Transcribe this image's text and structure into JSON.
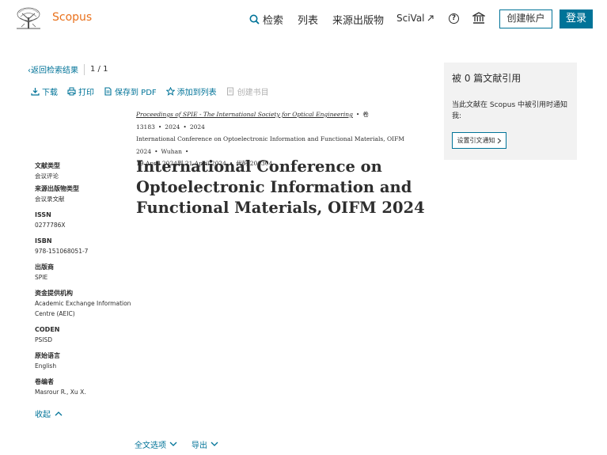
{
  "header": {
    "brand": "Scopus",
    "search_label": "检索",
    "lists_label": "列表",
    "sources_label": "来源出版物",
    "scival_label": "SciVal",
    "create_account_label": "创建帐户",
    "login_label": "登录"
  },
  "nav": {
    "back_label": "返回检索结果",
    "pager": "1 / 1"
  },
  "toolbar": {
    "download": "下载",
    "print": "打印",
    "save_pdf": "保存到 PDF",
    "add_list": "添加到列表",
    "create_bib": "创建书目"
  },
  "source": {
    "journal": "Proceedings of SPIE - The International Society for Optical Engineering",
    "volume": "卷 13183",
    "year1": "2024",
    "year2": "2024",
    "conference": "International Conference on Optoelectronic Information and Functional Materials, OIFM 2024",
    "location": "Wuhan",
    "dates": "19 April 2024到 21 April 2024",
    "code": "代码 201304"
  },
  "document_title": "International Conference on Optoelectronic Information and Functional Materials, OIFM 2024",
  "metadata": [
    {
      "label": "文献类型",
      "value": "会议评论"
    },
    {
      "label": "来源出版物类型",
      "value": "会议录文献"
    },
    {
      "label": "ISSN",
      "value": "0277786X"
    },
    {
      "label": "ISBN",
      "value": "978-151068051-7"
    },
    {
      "label": "出版商",
      "value": "SPIE"
    },
    {
      "label": "资金提供机构",
      "value": "Academic Exchange Information Centre (AEIC)"
    },
    {
      "label": "CODEN",
      "value": "PSISD"
    },
    {
      "label": "原始语言",
      "value": "English"
    },
    {
      "label": "卷编者",
      "value": "Masrour R., Xu X."
    }
  ],
  "collapse_label": "收起",
  "bottom": {
    "full_text": "全文选项",
    "export": "导出"
  },
  "cite_panel": {
    "title": "被 0 篇文献引用",
    "description": "当此文献在 Scopus 中被引用时通知我:",
    "button": "设置引文通知"
  },
  "colors": {
    "accent": "#007398",
    "brand": "#e9711c",
    "panel_bg": "#f2f2f2"
  },
  "icons": [
    "elsevier-tree-icon",
    "search-icon",
    "external-link-icon",
    "help-icon",
    "institution-icon",
    "chevron-left-icon",
    "download-icon",
    "print-icon",
    "pdf-icon",
    "star-icon",
    "bibliography-icon",
    "chevron-up-icon",
    "chevron-down-icon",
    "chevron-right-icon"
  ]
}
